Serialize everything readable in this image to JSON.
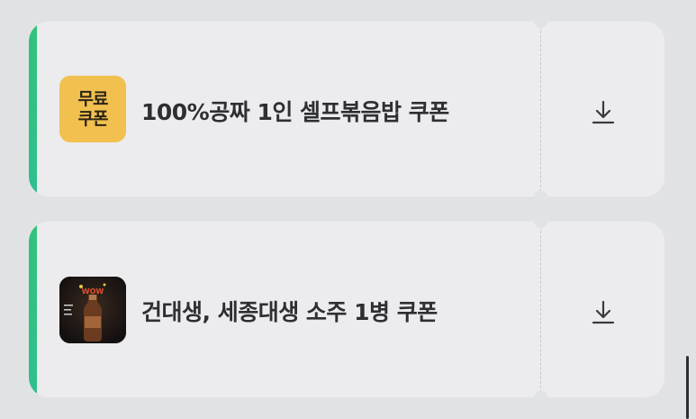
{
  "coupons": [
    {
      "title": "100%공짜 1인 셀프볶음밥 쿠폰",
      "thumbnail_text": "무료\n쿠폰",
      "thumbnail_color": "#f1c04f",
      "action_icon": "download-icon"
    },
    {
      "title": "건대생, 세종대생 소주 1병 쿠폰",
      "thumbnail_logo_text": "WOW",
      "thumbnail_image": "soju-bottle-photo",
      "action_icon": "download-icon"
    }
  ],
  "colors": {
    "background": "#e1e2e4",
    "card": "#ececee",
    "accent": "#33c27a",
    "title": "#2e2f33"
  }
}
